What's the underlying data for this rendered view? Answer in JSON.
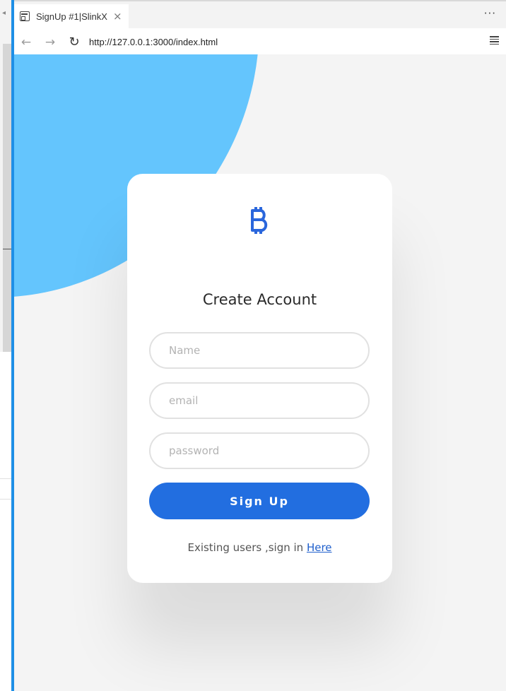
{
  "browser": {
    "tab_title": "SignUp #1|SlinkX",
    "tab_close": "×",
    "more": "···",
    "back": "←",
    "forward": "→",
    "refresh": "↻",
    "url": "http://127.0.0.1:3000/index.html"
  },
  "signup": {
    "icon": "bitcoin-icon",
    "title": "Create Account",
    "name_placeholder": "Name",
    "email_placeholder": "email",
    "password_placeholder": "password",
    "button_label": "Sign Up",
    "footer_prefix": "Existing users ,sign in ",
    "footer_link": "Here"
  },
  "colors": {
    "accent_bar": "#1e8fe6",
    "blob": "#64c5fd",
    "button": "#226ee0",
    "link": "#1f5fcc"
  }
}
